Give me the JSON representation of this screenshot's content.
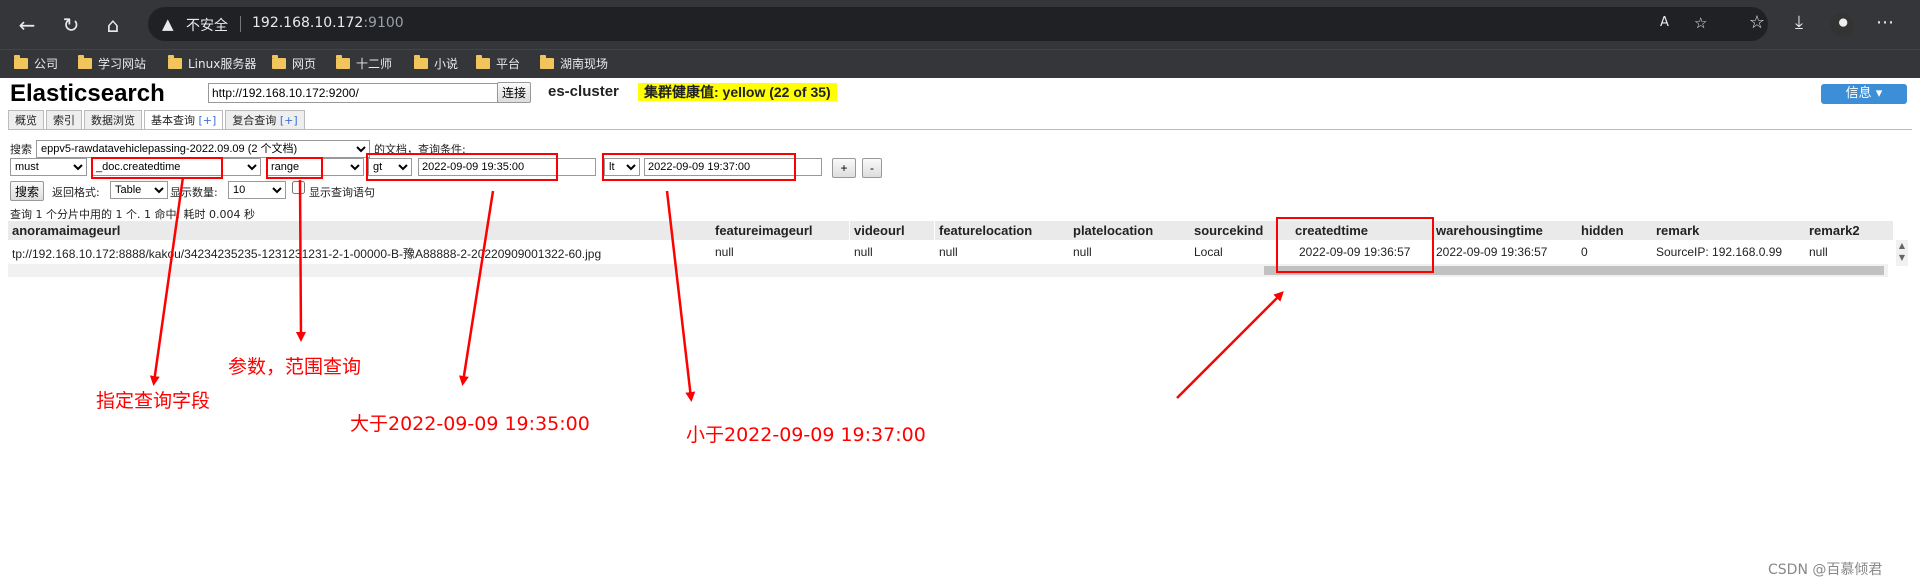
{
  "browser": {
    "insecure_label": "不安全",
    "host": "192.168.10.172",
    "port": ":9100",
    "bookmarks": [
      "公司",
      "学习网站",
      "Linux服务器",
      "网页",
      "十二师",
      "小说",
      "平台",
      "湖南现场"
    ]
  },
  "app": {
    "title": "Elasticsearch",
    "connect_url": "http://192.168.10.172:9200/",
    "connect_label": "连接",
    "cluster": "es-cluster",
    "health": "集群健康值: yellow (22 of 35)",
    "info_label": "信息 ▾"
  },
  "tabs": [
    {
      "label": "概览"
    },
    {
      "label": "索引"
    },
    {
      "label": "数据浏览"
    },
    {
      "label": "基本查询",
      "plus": "[+]"
    },
    {
      "label": "复合查询",
      "plus": "[+]"
    }
  ],
  "query": {
    "search_label": "搜索",
    "index_option": "eppv5-rawdatavehiclepassing-2022.09.09 (2 个文档)",
    "docs_label": "的文档，查询条件:",
    "bool": "must",
    "field": "_doc.createdtime",
    "type": "range",
    "op1": "gt",
    "val1": "2022-09-09 19:35:00",
    "op2": "lt",
    "val2": "2022-09-09 19:37:00",
    "add_btn": "+",
    "remove_btn": "-",
    "search_btn": "搜索",
    "format_label": "返回格式:",
    "format_value": "Table",
    "count_label": "显示数量:",
    "count_value": "10",
    "show_query_label": "显示查询语句",
    "result_summary": "查询 1 个分片中用的 1 个. 1 命中. 耗时 0.004 秒"
  },
  "table": {
    "headers": [
      "anoramaimageurl",
      "featureimageurl",
      "videourl",
      "featurelocation",
      "platelocation",
      "sourcekind",
      "createdtime",
      "warehousingtime",
      "hidden",
      "remark",
      "remark2"
    ],
    "row": [
      "tp://192.168.10.172:8888/kakou/34234235235-1231231231-2-1-00000-B-豫A88888-2-20220909001322-60.jpg",
      "null",
      "null",
      "null",
      "null",
      "Local",
      "2022-09-09 19:36:57",
      "2022-09-09 19:36:57",
      "0",
      "SourceIP: 192.168.0.99",
      "null"
    ]
  },
  "annotations": {
    "field": "指定查询字段",
    "range": "参数，范围查询",
    "gt": "大于2022-09-09 19:35:00",
    "lt": "小于2022-09-09 19:37:00"
  },
  "watermark": "CSDN @百慕倾君",
  "colors": {
    "annotation": "#ff0000",
    "health_bg": "#ffff00",
    "info_btn": "#3c8fd6",
    "chrome": "#35363a"
  }
}
